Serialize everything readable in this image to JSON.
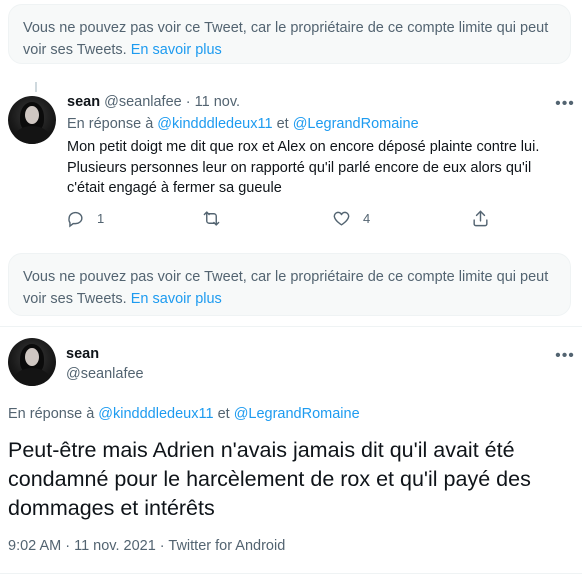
{
  "notices": {
    "top": {
      "text": "Vous ne pouvez pas voir ce Tweet, car le propriétaire de ce compte limite qui peut voir ses Tweets.",
      "link": "En savoir plus"
    },
    "middle": {
      "text": "Vous ne pouvez pas voir ce Tweet, car le propriétaire de ce compte limite qui peut voir ses Tweets.",
      "link": "En savoir plus"
    }
  },
  "reply_tweet": {
    "name": "sean",
    "handle": "@seanlafee",
    "separator": "·",
    "date": "11 nov.",
    "reply_prefix": "En réponse à",
    "mention_1": "@kindddledeux11",
    "reply_joiner": "et",
    "mention_2": "@LegrandRomaine",
    "text": "Mon petit doigt me dit que rox et Alex on encore déposé plainte contre lui. Plusieurs personnes leur on rapporté qu'il parlé encore de eux alors qu'il c'était engagé à fermer sa gueule",
    "actions": {
      "reply_count": "1",
      "retweet_count": "",
      "like_count": "4"
    },
    "icons": [
      "reply-icon",
      "retweet-icon",
      "like-icon",
      "share-icon",
      "more-icon"
    ]
  },
  "main_tweet": {
    "name": "sean",
    "handle": "@seanlafee",
    "reply_prefix": "En réponse à",
    "mention_1": "@kindddledeux11",
    "reply_joiner": "et",
    "mention_2": "@LegrandRomaine",
    "text": "Peut-être mais Adrien n'avais jamais dit qu'il avait été condamné pour le harcèlement de rox et qu'il payé des dommages et intérêts",
    "meta": "9:02 AM · 11 nov. 2021 · Twitter for Android"
  },
  "colors": {
    "link": "#1d9bf0",
    "secondary_text": "#536471",
    "primary_text": "#0f1419",
    "notice_bg": "#f7f9f9"
  }
}
